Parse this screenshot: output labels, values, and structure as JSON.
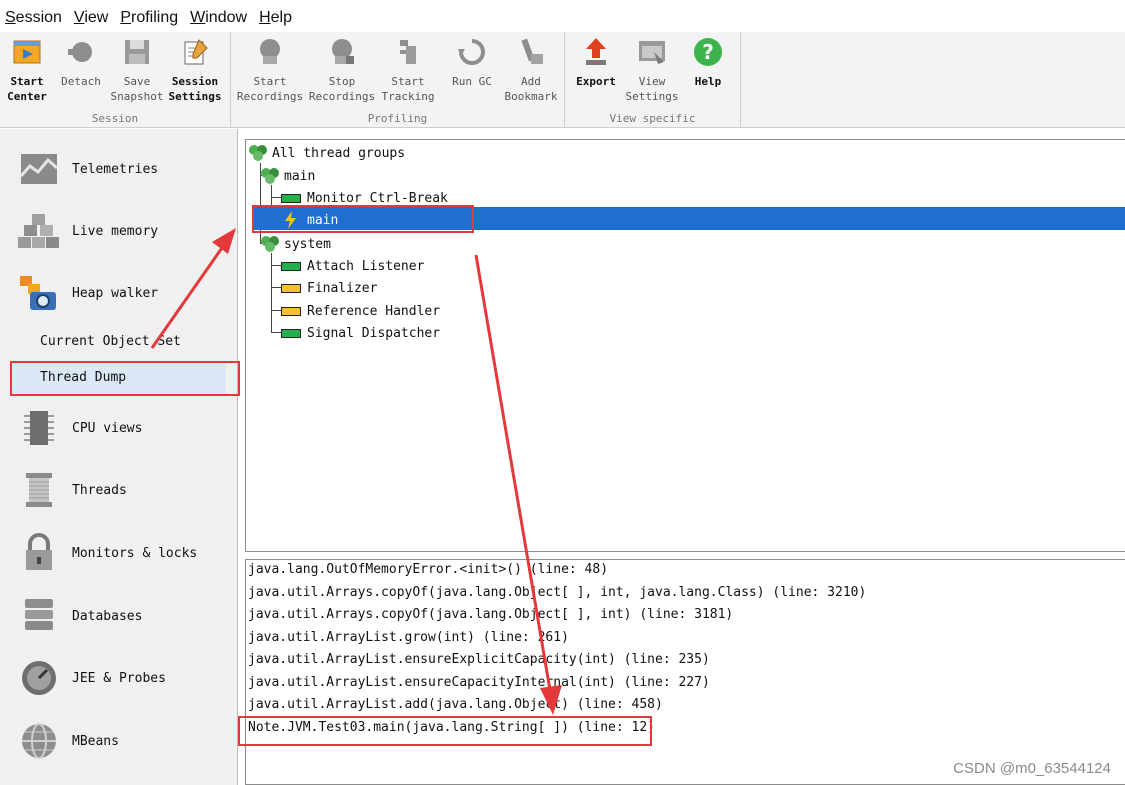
{
  "menu": [
    "Session",
    "View",
    "Profiling",
    "Window",
    "Help"
  ],
  "toolbar": {
    "groups": [
      {
        "label": "Session"
      },
      {
        "label": "Profiling"
      },
      {
        "label": "View specific"
      }
    ],
    "buttons": [
      {
        "line1": "Start",
        "line2": "Center",
        "icon": "start-center-icon"
      },
      {
        "line1": "Detach",
        "line2": "",
        "icon": "detach-icon"
      },
      {
        "line1": "Save",
        "line2": "Snapshot",
        "icon": "save-snapshot-icon"
      },
      {
        "line1": "Session",
        "line2": "Settings",
        "icon": "session-settings-icon"
      },
      {
        "line1": "Start",
        "line2": "Recordings",
        "icon": "start-recordings-icon"
      },
      {
        "line1": "Stop",
        "line2": "Recordings",
        "icon": "stop-recordings-icon"
      },
      {
        "line1": "Start",
        "line2": "Tracking",
        "icon": "start-tracking-icon"
      },
      {
        "line1": "Run GC",
        "line2": "",
        "icon": "run-gc-icon"
      },
      {
        "line1": "Add",
        "line2": "Bookmark",
        "icon": "add-bookmark-icon"
      },
      {
        "line1": "Export",
        "line2": "",
        "icon": "export-icon"
      },
      {
        "line1": "View",
        "line2": "Settings",
        "icon": "view-settings-icon"
      },
      {
        "line1": "Help",
        "line2": "",
        "icon": "help-icon"
      }
    ]
  },
  "nav": {
    "items": [
      "Telemetries",
      "Live memory",
      "Heap walker",
      "CPU views",
      "Threads",
      "Monitors & locks",
      "Databases",
      "JEE & Probes",
      "MBeans"
    ],
    "sub_items": [
      "Current Object Set",
      "Thread Dump"
    ],
    "selected": "Thread Dump"
  },
  "tree": {
    "root": "All thread groups",
    "groups": [
      {
        "name": "main",
        "threads": [
          "Monitor Ctrl-Break",
          "main"
        ]
      },
      {
        "name": "system",
        "threads": [
          "Attach Listener",
          "Finalizer",
          "Reference Handler",
          "Signal Dispatcher"
        ]
      }
    ],
    "selected": "main"
  },
  "stack": [
    "java.lang.OutOfMemoryError.<init>() (line: 48)",
    "java.util.Arrays.copyOf(java.lang.Object[ ], int, java.lang.Class) (line: 3210)",
    "java.util.Arrays.copyOf(java.lang.Object[ ], int) (line: 3181)",
    "java.util.ArrayList.grow(int) (line: 261)",
    "java.util.ArrayList.ensureExplicitCapacity(int) (line: 235)",
    "java.util.ArrayList.ensureCapacityInternal(int) (line: 227)",
    "java.util.ArrayList.add(java.lang.Object) (line: 458)",
    "Note.JVM.Test03.main(java.lang.String[ ]) (line: 12)"
  ],
  "colors": {
    "selection": "#1e6fd0",
    "annotation": "#e3393b",
    "thread_running": "#22b14c",
    "thread_waiting": "#f2c12e"
  },
  "watermark": "CSDN @m0_63544124"
}
